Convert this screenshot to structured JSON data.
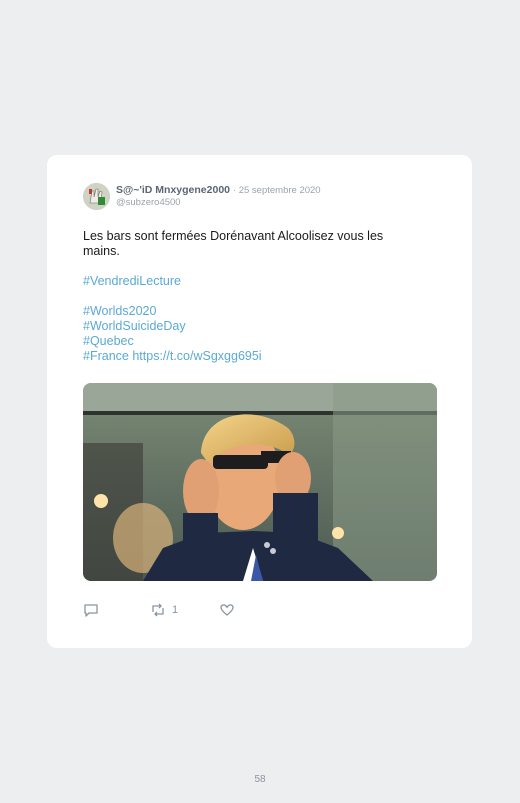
{
  "tweet": {
    "display_name": "S@~'iD Mnxygene2000",
    "date": "· 25 septembre 2020",
    "handle": "@subzero4500",
    "text_line1": "Les bars sont fermées Dorénavant Alcoolisez vous les",
    "text_line2": "mains.",
    "hashtag1": "#VendrediLecture",
    "hashtag2": "#Worlds2020",
    "hashtag3": "#WorldSuicideDay",
    "hashtag4": "#Quebec",
    "hashtag5": "#France",
    "url": "https://t.co/wSgxgg695i",
    "retweet_count": "1"
  },
  "icons": {
    "reply": "speech-bubble-icon",
    "retweet": "retweet-icon",
    "like": "heart-icon"
  },
  "colors": {
    "background": "#eceef0",
    "card": "#ffffff",
    "link": "#5aa9d6",
    "muted": "#9aa3ad"
  },
  "page": {
    "number": "58"
  }
}
